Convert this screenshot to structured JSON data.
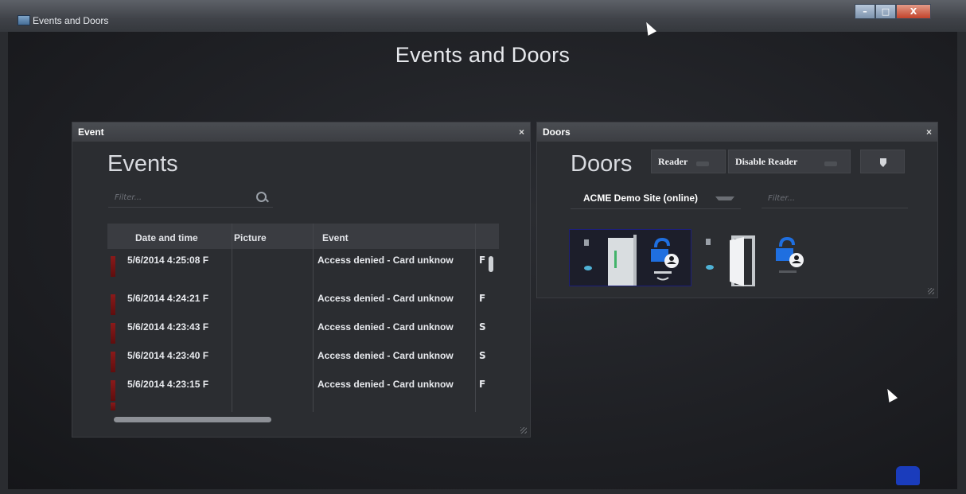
{
  "window": {
    "title": "Events and Doors",
    "controls": {
      "minimize": "–",
      "maximize": "□",
      "close": "X"
    }
  },
  "page": {
    "title": "Events and Doors"
  },
  "events_panel": {
    "header": "Event",
    "close": "×",
    "title": "Events",
    "filter_placeholder": "Filter...",
    "columns": [
      "Date and time",
      "Picture",
      "Event"
    ],
    "rows": [
      {
        "date": "5/6/2014 4:25:08 F",
        "event": "Access denied - Card unknow",
        "trunc": "F"
      },
      {
        "date": "5/6/2014 4:24:21 F",
        "event": "Access denied - Card unknow",
        "trunc": "F"
      },
      {
        "date": "5/6/2014 4:23:43 F",
        "event": "Access denied - Card unknow",
        "trunc": "S"
      },
      {
        "date": "5/6/2014 4:23:40 F",
        "event": "Access denied - Card unknow",
        "trunc": "S"
      },
      {
        "date": "5/6/2014 4:23:15 F",
        "event": "Access denied - Card unknow",
        "trunc": "F"
      }
    ]
  },
  "doors_panel": {
    "header": "Doors",
    "close": "×",
    "title": "Doors",
    "buttons": {
      "reader": "Reader",
      "disable_reader": "Disable Reader"
    },
    "site": "ACME Demo Site (online)",
    "filter_placeholder": "Filter..."
  },
  "colors": {
    "accent_blue": "#1f6fe0",
    "event_marker": "#8a1a1a",
    "selected_tile_border": "#1d1f7a"
  }
}
